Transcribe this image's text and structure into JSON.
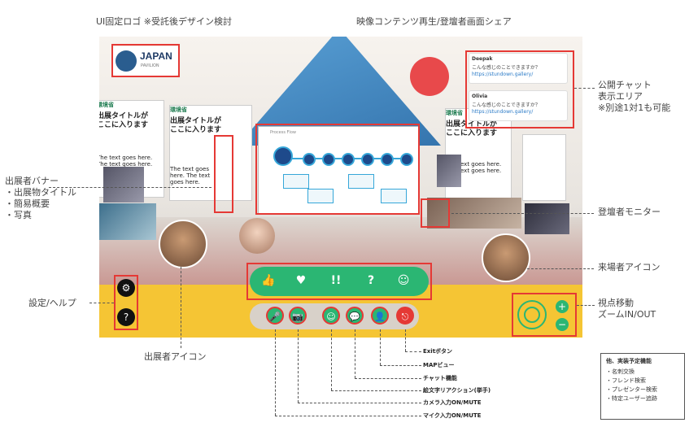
{
  "annotations": {
    "logo": "UI固定ロゴ ※受託後デザイン検討",
    "video": "映像コンテンツ再生/登壇者画面シェア",
    "chat": "公開チャット\n表示エリア\n※別途1対1も可能",
    "banner": "出展者バナー\n・出展物タイトル\n・簡易概要\n・写真",
    "monitor": "登壇者モニター",
    "visitor": "来場者アイコン",
    "settings": "設定/ヘルプ",
    "viewpoint": "視点移動\nズームIN/OUT",
    "exhibitor": "出展者アイコン"
  },
  "logo": {
    "title": "JAPAN",
    "subtitle": "PAVILION"
  },
  "panels": [
    {
      "org": "環境省",
      "title": "出展タイトルが\nここに入ります",
      "body": "The text goes here. The text goes here."
    },
    {
      "org": "環境省",
      "title": "出展タイトルが\nここに入ります",
      "body": "The text goes here. The text goes here."
    },
    {
      "org": "環境省",
      "title": "出展タイトルが\nここに入ります",
      "body": "The text goes here. The text goes here."
    }
  ],
  "chat": {
    "messages": [
      {
        "name": "Deepak",
        "text": "こんな感じのことできますか？",
        "link": "https://stundown.gallery/"
      },
      {
        "name": "Olivia",
        "text": "こんな感じのことできますか？",
        "link": "https://stundown.gallery/"
      }
    ]
  },
  "video": {
    "label": "Process Flow"
  },
  "reactions": [
    "👍",
    "♥",
    "!!",
    "?",
    "☺"
  ],
  "controls": [
    "🎤",
    "📷",
    "☺",
    "💬",
    "👤",
    "⎋"
  ],
  "settings_icons": [
    "⚙",
    "?"
  ],
  "zoom": [
    "+",
    "−"
  ],
  "button_labels": {
    "exit": "Exitボタン",
    "map": "MAPビュー",
    "chat": "チャット機能",
    "reaction": "絵文字リアクション(挙手)",
    "camera": "カメラ入力ON/MUTE",
    "mic": "マイク入力ON/MUTE"
  },
  "legend": {
    "title": "他、実装予定機能",
    "items": [
      "・名刺交換",
      "・フレンド検索",
      "・プレゼンター検索",
      "・特定ユーザー追跡"
    ]
  },
  "colors": {
    "accent": "#2bb673",
    "annotation": "#e53935",
    "floor": "#f5c534"
  }
}
